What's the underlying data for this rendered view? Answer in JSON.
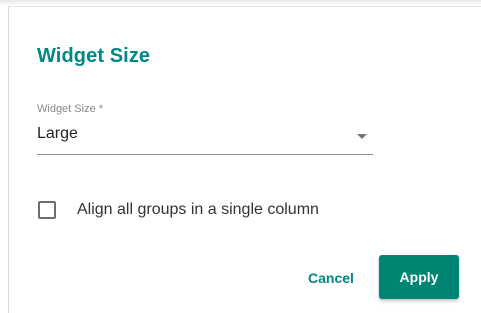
{
  "dialog": {
    "title": "Widget Size",
    "field": {
      "label": "Widget Size *",
      "value": "Large",
      "arrow_icon": "dropdown-arrow-icon"
    },
    "checkbox": {
      "label": "Align all groups in a single column",
      "checked": false
    },
    "buttons": {
      "cancel_label": "Cancel",
      "apply_label": "Apply"
    }
  },
  "colors": {
    "accent": "#008787",
    "primary_button": "#008573",
    "text": "#222222",
    "label": "#8a8a8a"
  }
}
